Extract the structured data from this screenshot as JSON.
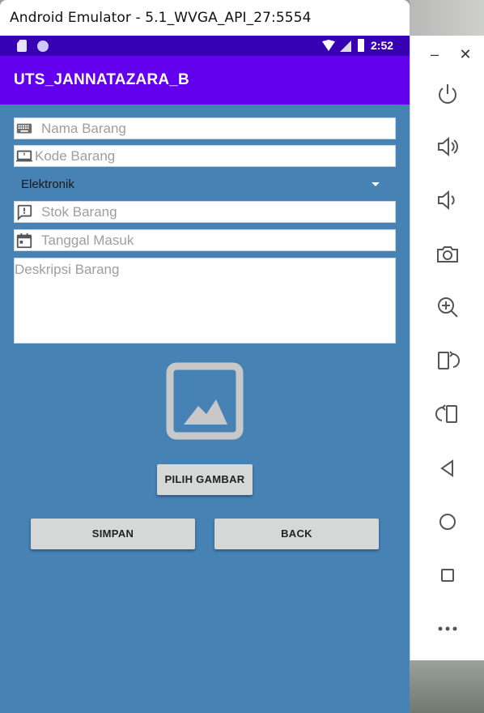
{
  "window": {
    "title": "Android Emulator - 5.1_WVGA_API_27:5554"
  },
  "status_bar": {
    "time": "2:52"
  },
  "app_bar": {
    "title": "UTS_JANNATAZARA_B"
  },
  "form": {
    "nama_barang": {
      "placeholder": "Nama Barang",
      "icon": "keyboard-icon"
    },
    "kode_barang": {
      "placeholder": "Kode Barang",
      "icon": "laptop-icon"
    },
    "kategori": {
      "selected": "Elektronik"
    },
    "stok_barang": {
      "placeholder": "Stok Barang",
      "icon": "message-icon"
    },
    "tanggal_masuk": {
      "placeholder": "Tanggal Masuk",
      "icon": "calendar-icon"
    },
    "deskripsi_barang": {
      "placeholder": "Deskripsi Barang"
    }
  },
  "image_placeholder": {
    "icon": "image-icon"
  },
  "buttons": {
    "pilih_gambar": "PILIH GAMBAR",
    "simpan": "SIMPAN",
    "back": "BACK"
  },
  "emulator_controls": {
    "minimize": "–",
    "close": "✕",
    "tools": [
      "power-icon",
      "volume-up-icon",
      "volume-down-icon",
      "camera-icon",
      "zoom-icon",
      "rotate-left-icon",
      "rotate-right-icon",
      "back-icon",
      "home-icon",
      "overview-icon",
      "more-icon"
    ]
  },
  "colors": {
    "status_bar": "#3700b3",
    "app_bar": "#6200ee",
    "background": "#4682b4"
  }
}
